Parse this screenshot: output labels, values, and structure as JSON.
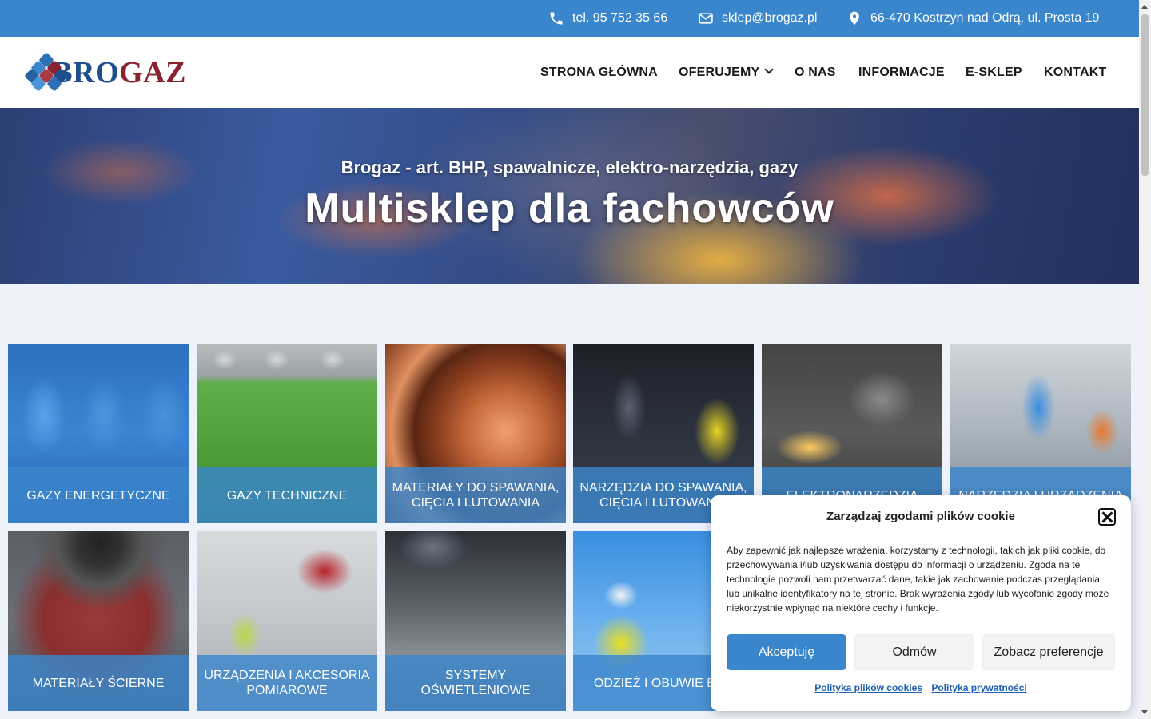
{
  "topbar": {
    "phone": "tel. 95 752 35 66",
    "email": "sklep@brogaz.pl",
    "address": "66-470 Kostrzyn nad Odrą, ul. Prosta 19",
    "icons": [
      "phone-icon",
      "mail-icon",
      "map-pin-icon"
    ]
  },
  "logo": {
    "text_first": "BRO",
    "text_second": "GAZ"
  },
  "nav": {
    "items": [
      {
        "label": "STRONA GŁÓWNA"
      },
      {
        "label": "OFERUJEMY",
        "has_dropdown": true
      },
      {
        "label": "O NAS"
      },
      {
        "label": "INFORMACJE"
      },
      {
        "label": "E-SKLEP"
      },
      {
        "label": "KONTAKT"
      }
    ]
  },
  "hero": {
    "subtitle": "Brogaz - art. BHP, spawalnicze, elektro-narzędzia, gazy",
    "title": "Multisklep dla fachowców"
  },
  "categories": [
    {
      "label": "GAZY ENERGETYCZNE"
    },
    {
      "label": "GAZY TECHNICZNE"
    },
    {
      "label": "MATERIAŁY DO SPAWANIA, CIĘCIA I LUTOWANIA"
    },
    {
      "label": "NARZĘDZIA DO SPAWANIA, CIĘCIA I LUTOWANIA"
    },
    {
      "label": "ELEKTRONARZĘDZIA"
    },
    {
      "label": "NARZĘDZIA I URZĄDZENIA"
    },
    {
      "label": "MATERIAŁY ŚCIERNE"
    },
    {
      "label": "URZĄDZENIA I AKCESORIA POMIAROWE"
    },
    {
      "label": "SYSTEMY OŚWIETLENIOWE"
    },
    {
      "label": "ODZIEŻ I OBUWIE BHP"
    }
  ],
  "cookie": {
    "title": "Zarządzaj zgodami plików cookie",
    "text": "Aby zapewnić jak najlepsze wrażenia, korzystamy z technologii, takich jak pliki cookie, do przechowywania i/lub uzyskiwania dostępu do informacji o urządzeniu. Zgoda na te technologie pozwoli nam przetwarzać dane, takie jak zachowanie podczas przeglądania lub unikalne identyfikatory na tej stronie. Brak wyrażenia zgody lub wycofanie zgody może niekorzystnie wpłynąć na niektóre cechy i funkcje.",
    "accept": "Akceptuję",
    "deny": "Odmów",
    "preferences": "Zobacz preferencje",
    "cookie_policy": "Polityka plików cookies",
    "privacy_policy": "Polityka prywatności"
  },
  "colors": {
    "brand_blue": "#3a86cc",
    "logo_red": "#8a2330",
    "logo_blue": "#1e4f8c",
    "page_bg": "#eef2fb"
  }
}
